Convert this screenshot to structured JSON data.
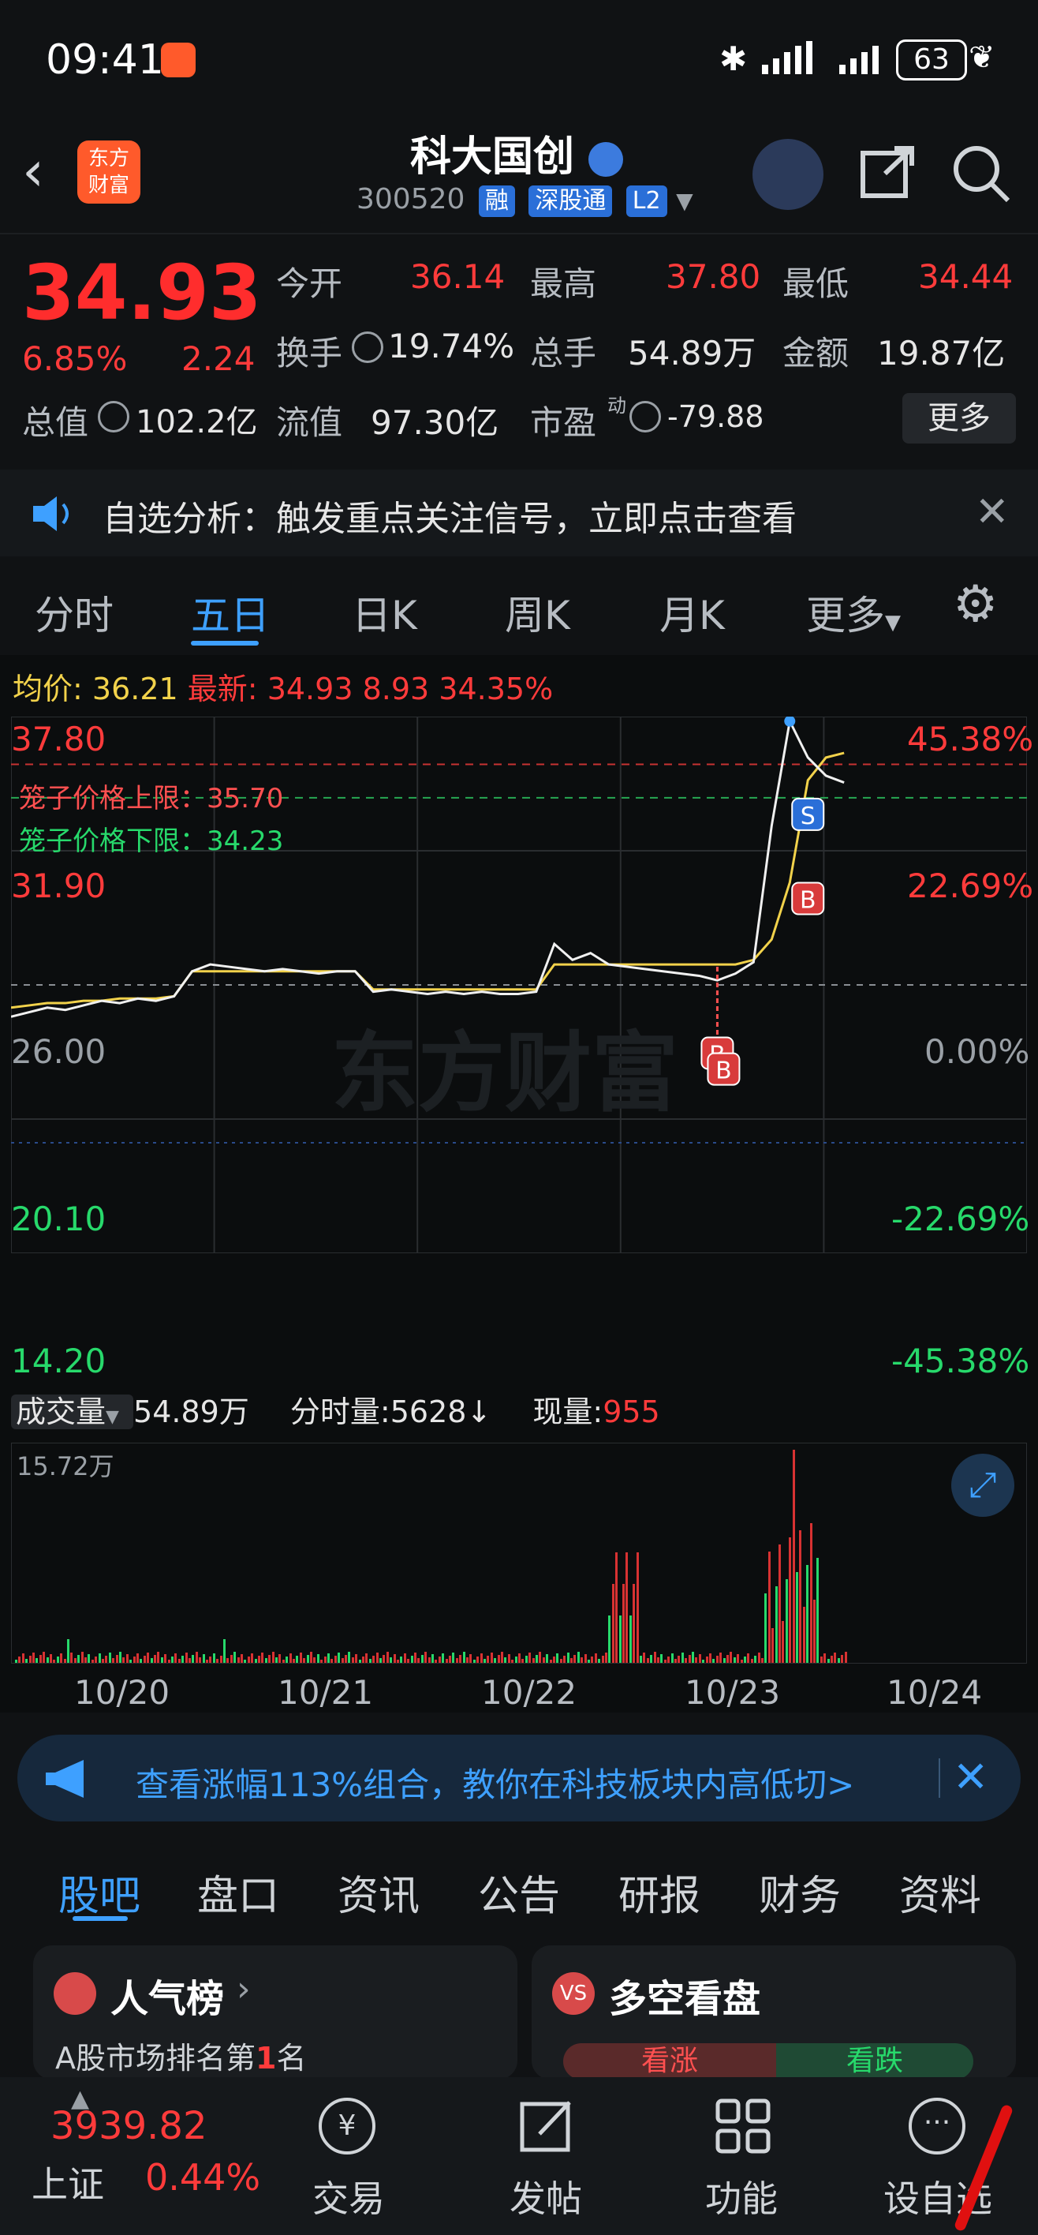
{
  "status": {
    "time": "09:41",
    "battery": "63"
  },
  "header": {
    "title": "科大国创",
    "code": "300520",
    "badges": [
      "融",
      "深股通",
      "L2"
    ],
    "app_logo_line1": "东方",
    "app_logo_line2": "财富"
  },
  "quote": {
    "price": "34.93",
    "change_pct": "6.85%",
    "change": "2.24",
    "stats": [
      {
        "label": "今开",
        "value": "36.14",
        "color": "red"
      },
      {
        "label": "最高",
        "value": "37.80",
        "color": "red"
      },
      {
        "label": "最低",
        "value": "34.44",
        "color": "red"
      },
      {
        "label": "换手",
        "value": "19.74%",
        "color": "white"
      },
      {
        "label": "总手",
        "value": "54.89万",
        "color": "white"
      },
      {
        "label": "金额",
        "value": "19.87亿",
        "color": "white"
      },
      {
        "label": "总值",
        "value": "102.2亿",
        "color": "white"
      },
      {
        "label": "流值",
        "value": "97.30亿",
        "color": "white"
      },
      {
        "label": "市盈",
        "value": "-79.88",
        "color": "white"
      }
    ],
    "pe_superscript": "动",
    "more_label": "更多"
  },
  "notice": {
    "text": "自选分析：触发重点关注信号，立即点击查看"
  },
  "tabs": [
    "分时",
    "五日",
    "日K",
    "周K",
    "月K",
    "更多"
  ],
  "active_tab": 1,
  "chart_info": {
    "avg_label": "均价:",
    "avg_value": "36.21",
    "latest_label": "最新:",
    "latest_value": "34.93",
    "latest_change": "8.93",
    "latest_pct": "34.35%",
    "cage_upper": "笼子价格上限：35.70",
    "cage_lower": "笼子价格下限：34.23",
    "watermark": "东方财富"
  },
  "chart_data": {
    "type": "line",
    "x_labels": [
      "10/20",
      "10/21",
      "10/22",
      "10/23",
      "10/24"
    ],
    "y_left_ticks": [
      "37.80",
      "31.90",
      "26.00",
      "20.10",
      "14.20"
    ],
    "y_right_ticks": [
      "45.38%",
      "22.69%",
      "0.00%",
      "-22.69%",
      "-45.38%"
    ],
    "ylim": [
      14.2,
      37.8
    ],
    "price_series": [
      24.6,
      24.8,
      25.0,
      24.9,
      25.1,
      25.3,
      25.2,
      25.4,
      25.3,
      25.5,
      26.6,
      26.9,
      26.8,
      26.7,
      26.6,
      26.7,
      26.6,
      26.5,
      26.6,
      26.6,
      25.7,
      25.8,
      25.7,
      25.6,
      25.7,
      25.6,
      25.7,
      25.6,
      25.6,
      25.7,
      27.8,
      27.1,
      27.4,
      26.9,
      26.8,
      26.7,
      26.6,
      26.5,
      26.4,
      26.2,
      26.5,
      27.0,
      33.0,
      37.6,
      36.0,
      35.2,
      34.9
    ],
    "avg_series": [
      25.0,
      25.1,
      25.2,
      25.2,
      25.3,
      25.3,
      25.4,
      25.4,
      25.4,
      25.5,
      26.6,
      26.6,
      26.6,
      26.6,
      26.6,
      26.6,
      26.6,
      26.6,
      26.6,
      26.6,
      25.8,
      25.8,
      25.8,
      25.8,
      25.8,
      25.8,
      25.8,
      25.8,
      25.8,
      25.8,
      26.9,
      26.9,
      26.9,
      26.9,
      26.9,
      26.9,
      26.9,
      26.9,
      26.9,
      26.9,
      26.9,
      27.1,
      28.0,
      30.5,
      35.0,
      36.0,
      36.2
    ],
    "markers": [
      {
        "label": "S",
        "color": "#2a6fd8"
      },
      {
        "label": "B",
        "color": "#d83b3b"
      },
      {
        "label": "B",
        "color": "#d83b3b"
      },
      {
        "label": "B",
        "color": "#d83b3b"
      }
    ],
    "cage_upper": 35.7,
    "cage_lower": 34.23
  },
  "volume": {
    "menu_label": "成交量",
    "total": "54.89万",
    "tick_label": "分时量:5628↓",
    "current_label": "现量:",
    "current_value": "955",
    "max_label": "15.72万"
  },
  "banner": {
    "text": "查看涨幅113%组合，教你在科技板块内高低切>"
  },
  "bottom_tabs": [
    "股吧",
    "盘口",
    "资讯",
    "公告",
    "研报",
    "财务",
    "资料"
  ],
  "bottom_active": 0,
  "cards": [
    {
      "title": "人气榜",
      "subtitle_pre": "A股市场排名第",
      "rank": "1",
      "subtitle_post": "名"
    },
    {
      "title": "多空看盘",
      "bull": "看涨",
      "bear": "看跌"
    }
  ],
  "nav": {
    "index_value": "3939.82",
    "index_name": "上证",
    "index_pct": "0.44%",
    "items": [
      "交易",
      "发帖",
      "功能",
      "设自选"
    ]
  }
}
